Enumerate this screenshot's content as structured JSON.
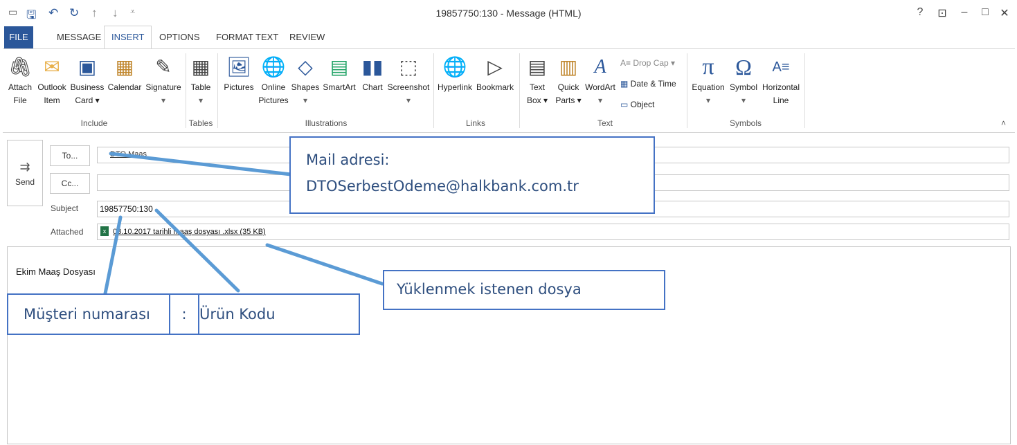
{
  "window": {
    "title": "19857750:130 - Message (HTML)",
    "controls": [
      "?",
      "⊡",
      "–",
      "□",
      "✕"
    ]
  },
  "tabs": {
    "file": "FILE",
    "message": "MESSAGE",
    "insert": "INSERT",
    "options": "OPTIONS",
    "format_text": "FORMAT TEXT",
    "review": "REVIEW"
  },
  "ribbon": {
    "attach_file": [
      "Attach",
      "File"
    ],
    "outlook_item": [
      "Outlook",
      "Item"
    ],
    "business_card": [
      "Business",
      "Card ▾"
    ],
    "calendar": [
      "Calendar",
      ""
    ],
    "signature": [
      "Signature",
      "▾"
    ],
    "table": [
      "Table",
      "▾"
    ],
    "pictures": [
      "Pictures",
      ""
    ],
    "online_pictures": [
      "Online",
      "Pictures"
    ],
    "shapes": [
      "Shapes",
      "▾"
    ],
    "smartart": [
      "SmartArt",
      ""
    ],
    "chart": [
      "Chart",
      ""
    ],
    "screenshot": [
      "Screenshot",
      "▾"
    ],
    "hyperlink": [
      "Hyperlink",
      ""
    ],
    "bookmark": [
      "Bookmark",
      ""
    ],
    "text_box": [
      "Text",
      "Box ▾"
    ],
    "quick_parts": [
      "Quick",
      "Parts ▾"
    ],
    "wordart": [
      "WordArt",
      "▾"
    ],
    "drop_cap": "Drop Cap ▾",
    "date_time": "Date & Time",
    "object": "Object",
    "equation": [
      "Equation",
      "▾"
    ],
    "symbol": [
      "Symbol",
      "▾"
    ],
    "horizontal_line": [
      "Horizontal",
      "Line"
    ],
    "groups": {
      "include": "Include",
      "tables": "Tables",
      "illustrations": "Illustrations",
      "links": "Links",
      "text": "Text",
      "symbols": "Symbols"
    }
  },
  "compose": {
    "send": "Send",
    "to_button": "To...",
    "cc_button": "Cc...",
    "to_value": "DTO Maaş",
    "cc_value": "",
    "subject_label": "Subject",
    "subject_value": "19857750:130",
    "attached_label": "Attached",
    "attachment": "03.10.2017 tarihli maaş dosyası .xlsx (35 KB)",
    "body_text": "Ekim Maaş Dosyası"
  },
  "annotations": {
    "mail_line1": "Mail adresi:",
    "mail_line2": "DTOSerbestOdeme@halkbank.com.tr",
    "file_note": "Yüklenmek istenen dosya",
    "customer_number": "Müşteri numarası",
    "separator": ":",
    "product_code": "Ürün Kodu"
  },
  "colors": {
    "accent": "#2b579a",
    "annotation_border": "#4472c4",
    "annotation_line": "#5b9bd5",
    "excel_green": "#217346"
  }
}
